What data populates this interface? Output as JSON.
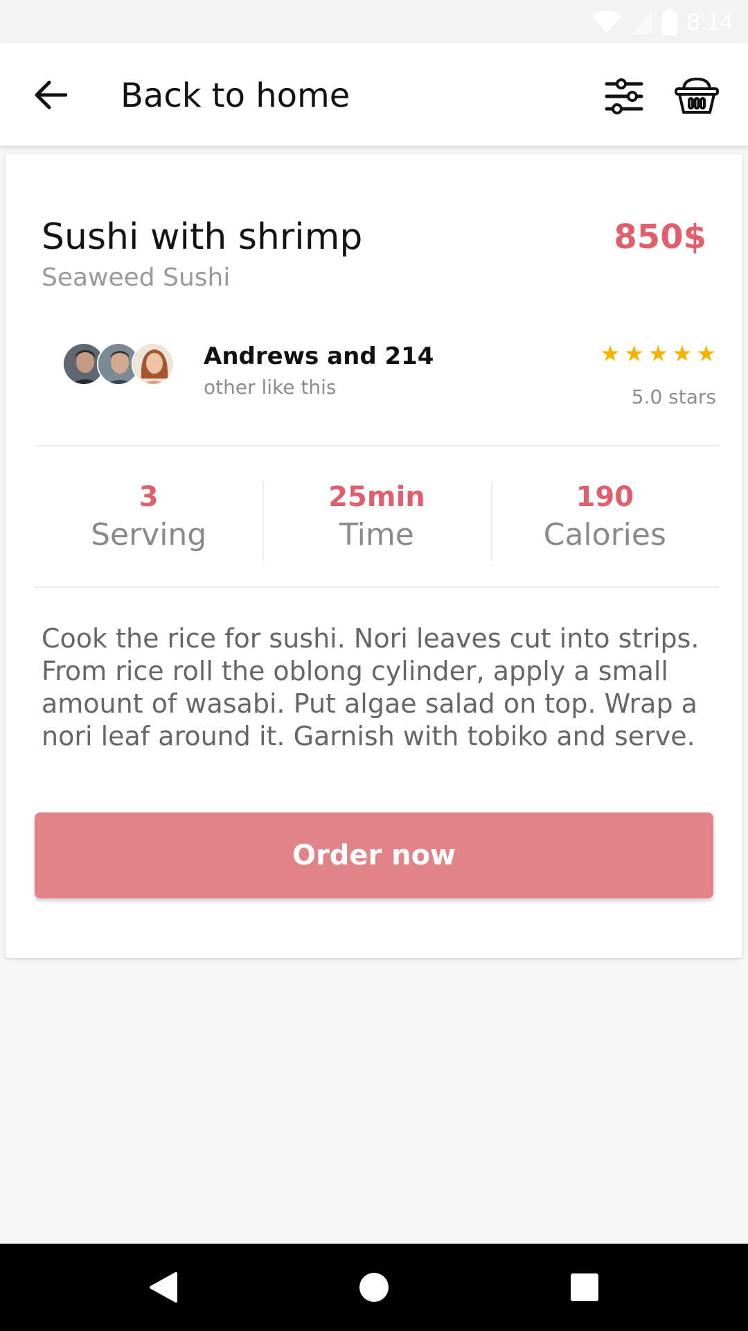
{
  "status_bar": {
    "time": "8:14"
  },
  "app_bar": {
    "title": "Back to home",
    "back_icon": "arrow-left-icon",
    "filter_icon": "sliders-icon",
    "basket_icon": "basket-icon"
  },
  "dish": {
    "name": "Sushi with shrimp",
    "subtitle": "Seaweed Sushi",
    "price": "850$"
  },
  "likes": {
    "title": "Andrews and 214",
    "subtitle": "other like this",
    "avatar_count": 3
  },
  "rating": {
    "stars": 5,
    "max_stars": 5,
    "text": "5.0 stars"
  },
  "stats": [
    {
      "value": "3",
      "label": "Serving"
    },
    {
      "value": "25min",
      "label": "Time"
    },
    {
      "value": "190",
      "label": "Calories"
    }
  ],
  "description": "Cook the rice for sushi. Nori leaves cut into strips. From rice roll the oblong cylinder, apply a small amount of wasabi. Put algae salad on top. Wrap a nori leaf around it. Garnish with tobiko and serve.",
  "order_button": {
    "label": "Order now"
  },
  "colors": {
    "accent": "#df5f6d",
    "button": "#e2838a",
    "star": "#f5b301"
  },
  "nav_bar": {
    "back_icon": "triangle-back-icon",
    "home_icon": "circle-home-icon",
    "recents_icon": "square-recents-icon"
  }
}
